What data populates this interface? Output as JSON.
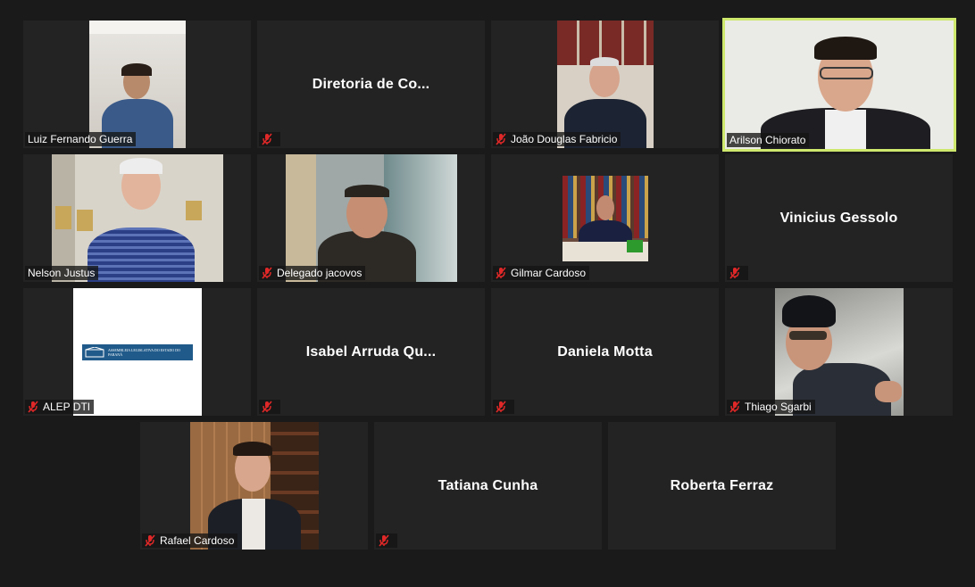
{
  "participants": [
    {
      "name": "Luiz Fernando Guerra",
      "muted": false,
      "video": true
    },
    {
      "name": "Diretoria de Co...",
      "muted": true,
      "video": false
    },
    {
      "name": "João Douglas Fabricio",
      "muted": true,
      "video": true
    },
    {
      "name": "Arilson Chiorato",
      "muted": false,
      "video": true,
      "speaking": true
    },
    {
      "name": "Nelson Justus",
      "muted": false,
      "video": true
    },
    {
      "name": "Delegado jacovos",
      "muted": true,
      "video": true
    },
    {
      "name": "Gilmar Cardoso",
      "muted": true,
      "video": true
    },
    {
      "name": "Vinicius Gessolo",
      "muted": true,
      "video": false
    },
    {
      "name": "ALEP DTI",
      "muted": true,
      "video": true
    },
    {
      "name": "Isabel Arruda Qu...",
      "muted": true,
      "video": false
    },
    {
      "name": "Daniela Motta",
      "muted": true,
      "video": false
    },
    {
      "name": "Thiago Sgarbi",
      "muted": true,
      "video": true
    },
    {
      "name": "Rafael Cardoso",
      "muted": true,
      "video": true
    },
    {
      "name": "Tatiana Cunha",
      "muted": true,
      "video": false
    },
    {
      "name": "Roberta Ferraz",
      "muted": false,
      "video": false
    }
  ],
  "alep_logo_text": "ASSEMBLEIA LEGISLATIVA DO ESTADO DO PARANÁ",
  "colors": {
    "background": "#1a1a1a",
    "tile": "#232323",
    "active_speaker_border": "#cde86c",
    "muted_icon": "#e02828"
  },
  "icons": {
    "muted": "microphone-muted-icon"
  }
}
